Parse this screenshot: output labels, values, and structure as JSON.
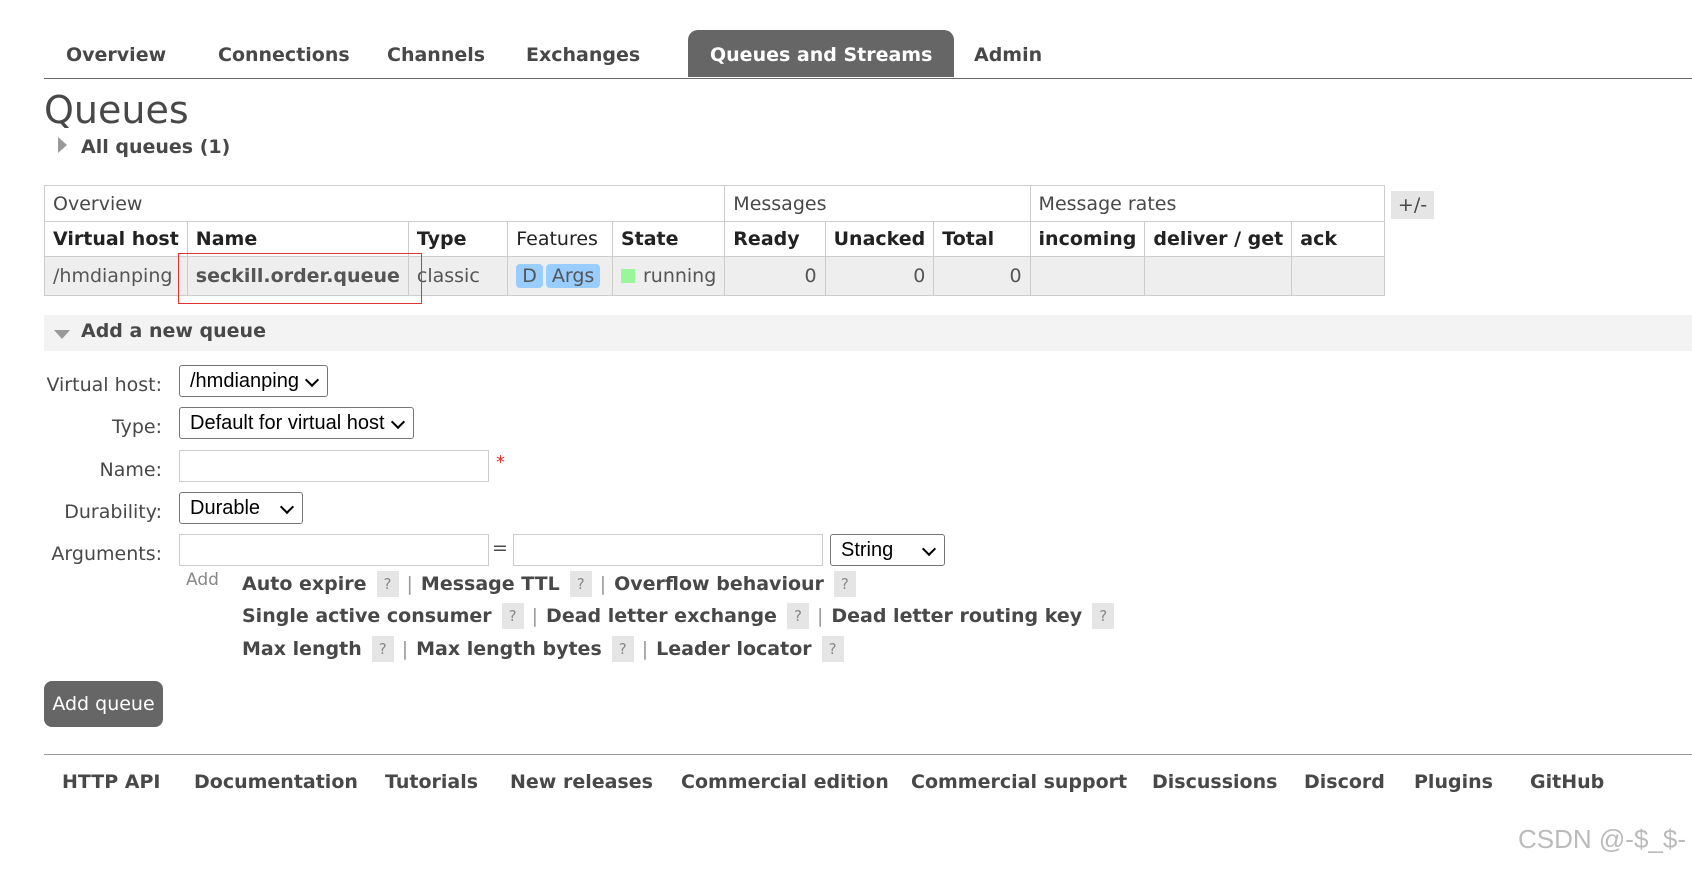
{
  "nav": {
    "tabs": [
      "Overview",
      "Connections",
      "Channels",
      "Exchanges",
      "Queues and Streams",
      "Admin"
    ],
    "active": "Queues and Streams"
  },
  "page_title": "Queues",
  "all_queues_label": "All queues (1)",
  "table": {
    "groups": [
      "Overview",
      "Messages",
      "Message rates"
    ],
    "columns": [
      "Virtual host",
      "Name",
      "Type",
      "Features",
      "State",
      "Ready",
      "Unacked",
      "Total",
      "incoming",
      "deliver / get",
      "ack"
    ],
    "rows": [
      {
        "vhost": "/hmdianping",
        "name": "seckill.order.queue",
        "type": "classic",
        "features": [
          "D",
          "Args"
        ],
        "state": "running",
        "ready": "0",
        "unacked": "0",
        "total": "0",
        "incoming": "",
        "deliver_get": "",
        "ack": ""
      }
    ],
    "toggle_columns_label": "+/-"
  },
  "add_queue": {
    "header": "Add a new queue",
    "labels": {
      "vhost": "Virtual host:",
      "type": "Type:",
      "name": "Name:",
      "durability": "Durability:",
      "arguments": "Arguments:"
    },
    "vhost_value": "/hmdianping",
    "type_value": "Default for virtual host",
    "durability_value": "Durable",
    "arg_type_value": "String",
    "required_marker": "*",
    "equals": "=",
    "add_label": "Add",
    "help_label": "?",
    "separator": "|",
    "argument_shortcuts": [
      [
        "Auto expire",
        "Message TTL",
        "Overflow behaviour"
      ],
      [
        "Single active consumer",
        "Dead letter exchange",
        "Dead letter routing key"
      ],
      [
        "Max length",
        "Max length bytes",
        "Leader locator"
      ]
    ],
    "submit_label": "Add queue"
  },
  "footer": {
    "links": [
      "HTTP API",
      "Documentation",
      "Tutorials",
      "New releases",
      "Commercial edition",
      "Commercial support",
      "Discussions",
      "Discord",
      "Plugins",
      "GitHub"
    ]
  },
  "watermark": "CSDN @-$_$-",
  "colors": {
    "active_tab": "#666666",
    "state_running": "#98f898",
    "feature_badge": "#99ccff",
    "highlight_box": "#dd3333"
  }
}
